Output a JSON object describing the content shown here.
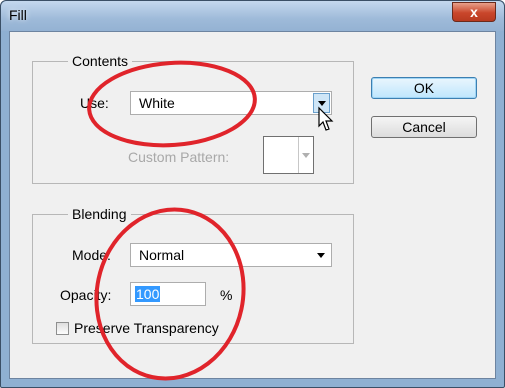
{
  "window": {
    "title": "Fill",
    "close_glyph": "x"
  },
  "contents": {
    "legend": "Contents",
    "use_label": "Use:",
    "use_value": "White",
    "custom_pattern_label": "Custom Pattern:"
  },
  "blending": {
    "legend": "Blending",
    "mode_label": "Mode:",
    "mode_value": "Normal",
    "opacity_label": "Opacity:",
    "opacity_value": "100",
    "opacity_unit": "%",
    "preserve_label": "Preserve Transparency",
    "preserve_checked": false
  },
  "buttons": {
    "ok": "OK",
    "cancel": "Cancel"
  },
  "annotation": {
    "color": "#e0242b"
  }
}
